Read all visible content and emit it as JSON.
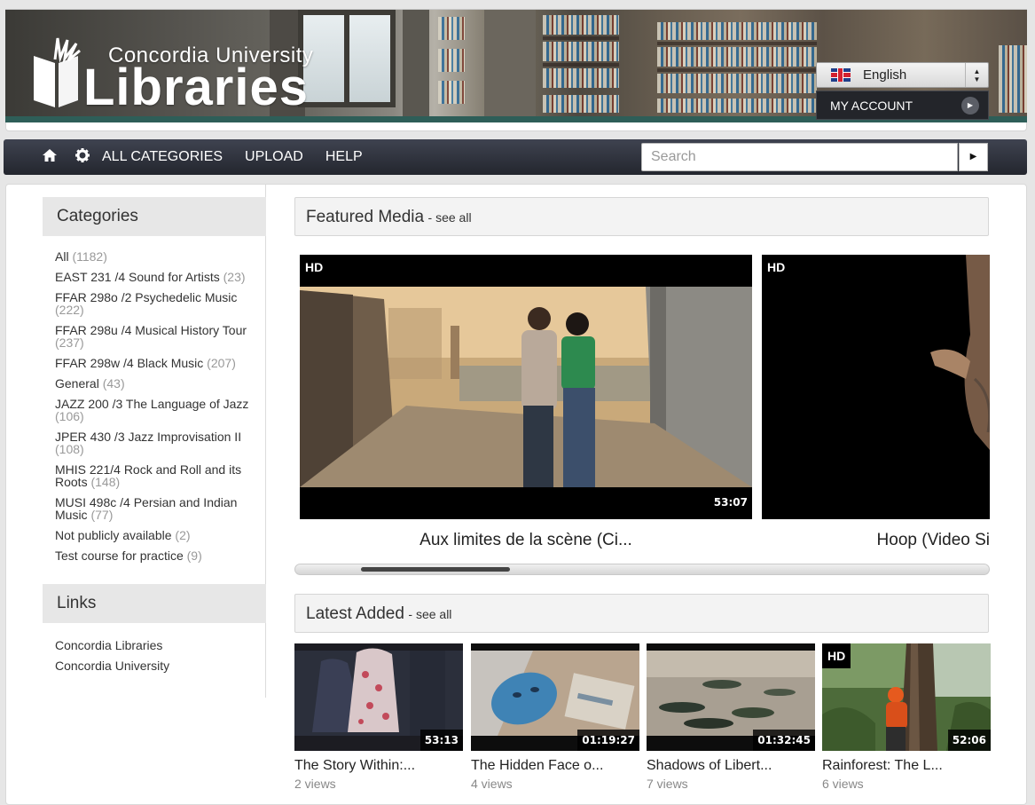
{
  "header": {
    "logo_small": "Concordia University",
    "logo_big": "Libraries",
    "language": {
      "selected": "English",
      "flag": "uk-flag-icon"
    },
    "my_account_label": "MY ACCOUNT"
  },
  "nav": {
    "icons": [
      "home-icon",
      "gear-icon"
    ],
    "links": [
      "ALL CATEGORIES",
      "UPLOAD",
      "HELP"
    ],
    "search_placeholder": "Search"
  },
  "sidebar": {
    "categories_title": "Categories",
    "categories": [
      {
        "name": "All",
        "count": "(1182)"
      },
      {
        "name": "EAST 231 /4 Sound for Artists",
        "count": "(23)"
      },
      {
        "name": "FFAR 298o /2 Psychedelic Music",
        "count": "(222)"
      },
      {
        "name": "FFAR 298u /4 Musical History Tour",
        "count": "(237)"
      },
      {
        "name": "FFAR 298w /4 Black Music",
        "count": "(207)"
      },
      {
        "name": "General",
        "count": "(43)"
      },
      {
        "name": "JAZZ 200 /3 The Language of Jazz",
        "count": "(106)"
      },
      {
        "name": "JPER 430 /3 Jazz Improvisation II",
        "count": "(108)"
      },
      {
        "name": "MHIS 221/4 Rock and Roll and its Roots",
        "count": "(148)"
      },
      {
        "name": "MUSI 498c /4 Persian and Indian Music",
        "count": "(77)"
      },
      {
        "name": "Not publicly available",
        "count": "(2)"
      },
      {
        "name": "Test course for practice",
        "count": "(9)"
      }
    ],
    "links_title": "Links",
    "links": [
      "Concordia Libraries",
      "Concordia University"
    ]
  },
  "featured": {
    "title": "Featured Media",
    "see_all": "- see all",
    "items": [
      {
        "title": "Aux limites de la scène (Ci...",
        "badge": "HD",
        "duration": "53:07"
      },
      {
        "title": "Hoop (Video Si",
        "badge": "HD",
        "duration": ""
      }
    ]
  },
  "latest": {
    "title": "Latest Added",
    "see_all": "- see all",
    "items": [
      {
        "title": "The Story Within:...",
        "views": "2 views",
        "duration": "53:13",
        "badge": ""
      },
      {
        "title": "The Hidden Face o...",
        "views": "4 views",
        "duration": "01:19:27",
        "badge": ""
      },
      {
        "title": "Shadows of Libert...",
        "views": "7 views",
        "duration": "01:32:45",
        "badge": ""
      },
      {
        "title": "Rainforest: The L...",
        "views": "6 views",
        "duration": "52:06",
        "badge": "HD"
      }
    ]
  },
  "carousel_scroll_position": 0.12
}
